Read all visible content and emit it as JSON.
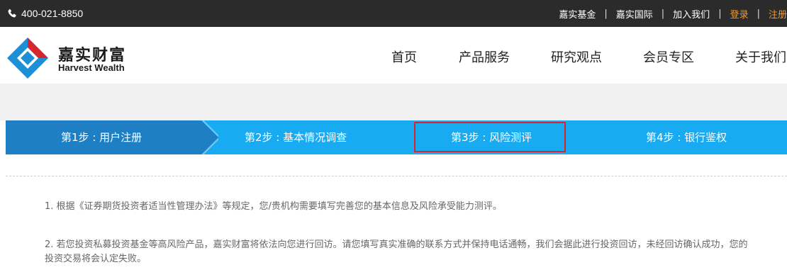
{
  "topbar": {
    "phone": "400-021-8850",
    "links": [
      {
        "label": "嘉实基金",
        "highlight": false
      },
      {
        "label": "嘉实国际",
        "highlight": false
      },
      {
        "label": "加入我们",
        "highlight": false
      },
      {
        "label": "登录",
        "highlight": true
      },
      {
        "label": "注册",
        "highlight": true
      }
    ],
    "separator": "|"
  },
  "logo": {
    "cn": "嘉实财富",
    "en": "Harvest Wealth"
  },
  "nav": [
    "首页",
    "产品服务",
    "研究观点",
    "会员专区",
    "关于我们"
  ],
  "steps": [
    {
      "label": "第1步 : 用户注册",
      "state": "done"
    },
    {
      "label": "第2步 : 基本情况调查",
      "state": "todo"
    },
    {
      "label": "第3步 : 风险测评",
      "state": "current"
    },
    {
      "label": "第4步 : 银行鉴权",
      "state": "todo"
    }
  ],
  "content": {
    "para1": "1. 根据《证券期货投资者适当性管理办法》等规定，您/贵机构需要填写完善您的基本信息及风险承受能力测评。",
    "para2": "2. 若您投资私募投资基金等高风险产品，嘉实财富将依法向您进行回访。请您填写真实准确的联系方式并保持电话通畅，我们会据此进行投资回访，未经回访确认成功，您的投资交易将会认定失败。"
  },
  "colors": {
    "topbar_bg": "#2b2b2b",
    "accent_orange": "#f29a2e",
    "step_done": "#1f7fc4",
    "step_todo": "#19abf1",
    "highlight_red": "#d9262c"
  }
}
